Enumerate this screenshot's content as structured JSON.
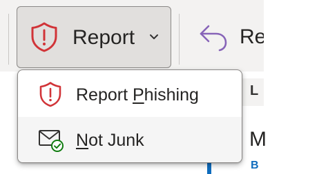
{
  "ribbon": {
    "report_button": {
      "label": "Report",
      "icon": "shield-warning-icon",
      "dropdown_icon": "chevron-down-icon"
    },
    "reply_button": {
      "label": "Re",
      "icon": "reply-arrow-icon"
    }
  },
  "report_menu": {
    "items": [
      {
        "label_before": "Report ",
        "access_key": "P",
        "label_after": "hishing",
        "icon": "shield-warning-icon"
      },
      {
        "label_before": "",
        "access_key": "N",
        "label_after": "ot Junk",
        "icon": "mail-check-icon"
      }
    ]
  },
  "message_list": {
    "header_label": "L",
    "sender_initial": "M",
    "preview_initial": "B"
  },
  "colors": {
    "shield_red": "#d13438",
    "reply_purple": "#8764b8",
    "check_green": "#107c10",
    "accent_blue": "#0f6cbd"
  }
}
